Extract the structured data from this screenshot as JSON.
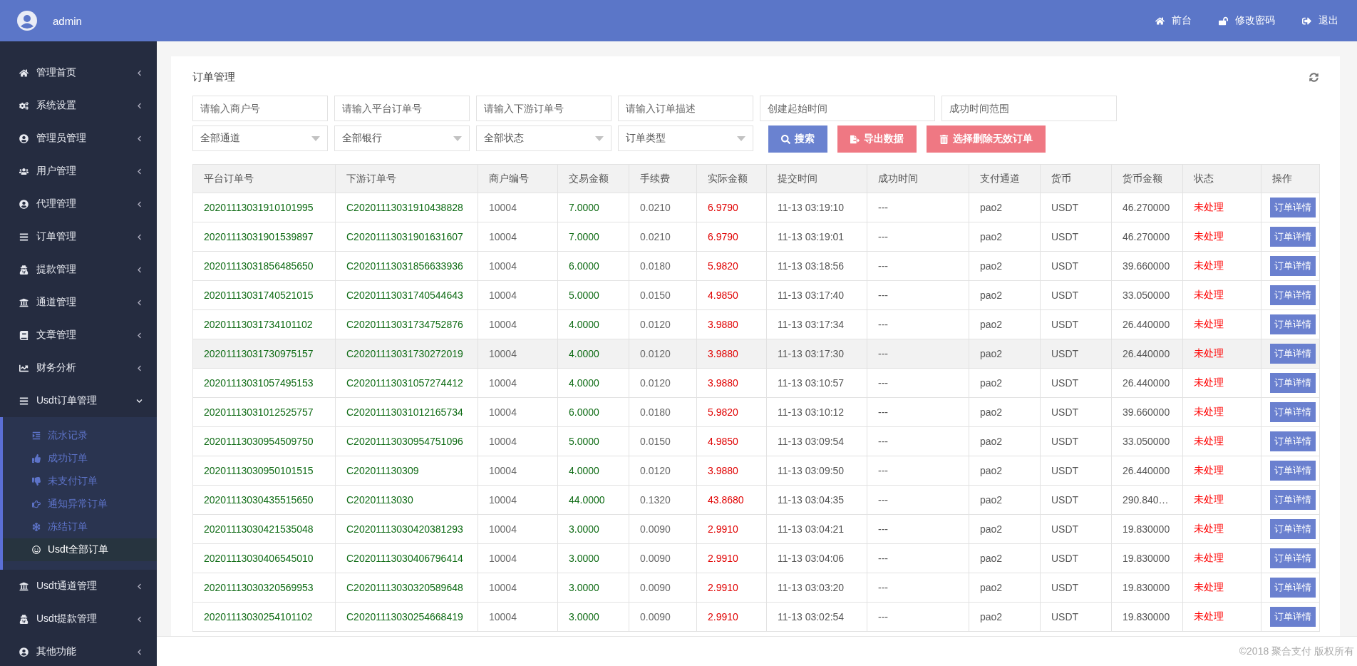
{
  "topbar": {
    "user": "admin",
    "links": [
      {
        "label": "前台"
      },
      {
        "label": "修改密码"
      },
      {
        "label": "退出"
      }
    ]
  },
  "sidebar": {
    "items": [
      {
        "label": "管理首页",
        "expanded": false
      },
      {
        "label": "系统设置",
        "expanded": false
      },
      {
        "label": "管理员管理",
        "expanded": false
      },
      {
        "label": "用户管理",
        "expanded": false
      },
      {
        "label": "代理管理",
        "expanded": false
      },
      {
        "label": "订单管理",
        "expanded": false
      },
      {
        "label": "提款管理",
        "expanded": false
      },
      {
        "label": "通道管理",
        "expanded": false
      },
      {
        "label": "文章管理",
        "expanded": false
      },
      {
        "label": "财务分析",
        "expanded": false
      },
      {
        "label": "Usdt订单管理",
        "expanded": true,
        "children": [
          {
            "label": "流水记录",
            "selected": false
          },
          {
            "label": "成功订单",
            "selected": false
          },
          {
            "label": "未支付订单",
            "selected": false
          },
          {
            "label": "通知异常订单",
            "selected": false
          },
          {
            "label": "冻结订单",
            "selected": false
          },
          {
            "label": "Usdt全部订单",
            "selected": true
          }
        ]
      },
      {
        "label": "Usdt通道管理",
        "expanded": false
      },
      {
        "label": "Usdt提款管理",
        "expanded": false
      },
      {
        "label": "其他功能",
        "expanded": false
      }
    ]
  },
  "panel": {
    "title": "订单管理",
    "filters": {
      "inputs": [
        {
          "placeholder": "请输入商户号",
          "kind": "narrow"
        },
        {
          "placeholder": "请输入平台订单号",
          "kind": "narrow"
        },
        {
          "placeholder": "请输入下游订单号",
          "kind": "narrow"
        },
        {
          "placeholder": "请输入订单描述",
          "kind": "narrow"
        },
        {
          "placeholder": "创建起始时间",
          "kind": "wide"
        },
        {
          "placeholder": "成功时间范围",
          "kind": "wide"
        }
      ],
      "selects": [
        {
          "value": "全部通道"
        },
        {
          "value": "全部银行"
        },
        {
          "value": "全部状态"
        },
        {
          "value": "订单类型"
        }
      ],
      "buttons": [
        {
          "label": "搜索",
          "kind": "primary"
        },
        {
          "label": "导出数据",
          "kind": "danger"
        },
        {
          "label": "选择删除无效订单",
          "kind": "danger"
        }
      ]
    },
    "table": {
      "columns": [
        "平台订单号",
        "下游订单号",
        "商户编号",
        "交易金额",
        "手续费",
        "实际金额",
        "提交时间",
        "成功时间",
        "支付通道",
        "货币",
        "货币金额",
        "状态",
        "操作"
      ],
      "rows": [
        {
          "platform_no": "20201113031910101995",
          "downstream_no": "C20201113031910438828",
          "merchant": "10004",
          "amount": "7.0000",
          "fee": "0.0210",
          "actual": "6.9790",
          "submitted": "11-13 03:19:10",
          "succeeded": "---",
          "channel": "pao2",
          "currency": "USDT",
          "coin_amount": "46.270000",
          "status": "未处理",
          "action": "订单详情",
          "hovered": false
        },
        {
          "platform_no": "20201113031901539897",
          "downstream_no": "C20201113031901631607",
          "merchant": "10004",
          "amount": "7.0000",
          "fee": "0.0210",
          "actual": "6.9790",
          "submitted": "11-13 03:19:01",
          "succeeded": "---",
          "channel": "pao2",
          "currency": "USDT",
          "coin_amount": "46.270000",
          "status": "未处理",
          "action": "订单详情",
          "hovered": false
        },
        {
          "platform_no": "20201113031856485650",
          "downstream_no": "C20201113031856633936",
          "merchant": "10004",
          "amount": "6.0000",
          "fee": "0.0180",
          "actual": "5.9820",
          "submitted": "11-13 03:18:56",
          "succeeded": "---",
          "channel": "pao2",
          "currency": "USDT",
          "coin_amount": "39.660000",
          "status": "未处理",
          "action": "订单详情",
          "hovered": false
        },
        {
          "platform_no": "20201113031740521015",
          "downstream_no": "C20201113031740544643",
          "merchant": "10004",
          "amount": "5.0000",
          "fee": "0.0150",
          "actual": "4.9850",
          "submitted": "11-13 03:17:40",
          "succeeded": "---",
          "channel": "pao2",
          "currency": "USDT",
          "coin_amount": "33.050000",
          "status": "未处理",
          "action": "订单详情",
          "hovered": false
        },
        {
          "platform_no": "20201113031734101102",
          "downstream_no": "C20201113031734752876",
          "merchant": "10004",
          "amount": "4.0000",
          "fee": "0.0120",
          "actual": "3.9880",
          "submitted": "11-13 03:17:34",
          "succeeded": "---",
          "channel": "pao2",
          "currency": "USDT",
          "coin_amount": "26.440000",
          "status": "未处理",
          "action": "订单详情",
          "hovered": false
        },
        {
          "platform_no": "20201113031730975157",
          "downstream_no": "C20201113031730272019",
          "merchant": "10004",
          "amount": "4.0000",
          "fee": "0.0120",
          "actual": "3.9880",
          "submitted": "11-13 03:17:30",
          "succeeded": "---",
          "channel": "pao2",
          "currency": "USDT",
          "coin_amount": "26.440000",
          "status": "未处理",
          "action": "订单详情",
          "hovered": true
        },
        {
          "platform_no": "20201113031057495153",
          "downstream_no": "C20201113031057274412",
          "merchant": "10004",
          "amount": "4.0000",
          "fee": "0.0120",
          "actual": "3.9880",
          "submitted": "11-13 03:10:57",
          "succeeded": "---",
          "channel": "pao2",
          "currency": "USDT",
          "coin_amount": "26.440000",
          "status": "未处理",
          "action": "订单详情",
          "hovered": false
        },
        {
          "platform_no": "20201113031012525757",
          "downstream_no": "C20201113031012165734",
          "merchant": "10004",
          "amount": "6.0000",
          "fee": "0.0180",
          "actual": "5.9820",
          "submitted": "11-13 03:10:12",
          "succeeded": "---",
          "channel": "pao2",
          "currency": "USDT",
          "coin_amount": "39.660000",
          "status": "未处理",
          "action": "订单详情",
          "hovered": false
        },
        {
          "platform_no": "20201113030954509750",
          "downstream_no": "C20201113030954751096",
          "merchant": "10004",
          "amount": "5.0000",
          "fee": "0.0150",
          "actual": "4.9850",
          "submitted": "11-13 03:09:54",
          "succeeded": "---",
          "channel": "pao2",
          "currency": "USDT",
          "coin_amount": "33.050000",
          "status": "未处理",
          "action": "订单详情",
          "hovered": false
        },
        {
          "platform_no": "20201113030950101515",
          "downstream_no": "C202011130309",
          "merchant": "10004",
          "amount": "4.0000",
          "fee": "0.0120",
          "actual": "3.9880",
          "submitted": "11-13 03:09:50",
          "succeeded": "---",
          "channel": "pao2",
          "currency": "USDT",
          "coin_amount": "26.440000",
          "status": "未处理",
          "action": "订单详情",
          "hovered": false
        },
        {
          "platform_no": "20201113030435515650",
          "downstream_no": "C20201113030",
          "merchant": "10004",
          "amount": "44.0000",
          "fee": "0.1320",
          "actual": "43.8680",
          "submitted": "11-13 03:04:35",
          "succeeded": "---",
          "channel": "pao2",
          "currency": "USDT",
          "coin_amount": "290.840…",
          "status": "未处理",
          "action": "订单详情",
          "hovered": false
        },
        {
          "platform_no": "20201113030421535048",
          "downstream_no": "C20201113030420381293",
          "merchant": "10004",
          "amount": "3.0000",
          "fee": "0.0090",
          "actual": "2.9910",
          "submitted": "11-13 03:04:21",
          "succeeded": "---",
          "channel": "pao2",
          "currency": "USDT",
          "coin_amount": "19.830000",
          "status": "未处理",
          "action": "订单详情",
          "hovered": false
        },
        {
          "platform_no": "20201113030406545010",
          "downstream_no": "C20201113030406796414",
          "merchant": "10004",
          "amount": "3.0000",
          "fee": "0.0090",
          "actual": "2.9910",
          "submitted": "11-13 03:04:06",
          "succeeded": "---",
          "channel": "pao2",
          "currency": "USDT",
          "coin_amount": "19.830000",
          "status": "未处理",
          "action": "订单详情",
          "hovered": false
        },
        {
          "platform_no": "20201113030320569953",
          "downstream_no": "C20201113030320589648",
          "merchant": "10004",
          "amount": "3.0000",
          "fee": "0.0090",
          "actual": "2.9910",
          "submitted": "11-13 03:03:20",
          "succeeded": "---",
          "channel": "pao2",
          "currency": "USDT",
          "coin_amount": "19.830000",
          "status": "未处理",
          "action": "订单详情",
          "hovered": false
        },
        {
          "platform_no": "20201113030254101102",
          "downstream_no": "C20201113030254668419",
          "merchant": "10004",
          "amount": "3.0000",
          "fee": "0.0090",
          "actual": "2.9910",
          "submitted": "11-13 03:02:54",
          "succeeded": "---",
          "channel": "pao2",
          "currency": "USDT",
          "coin_amount": "19.830000",
          "status": "未处理",
          "action": "订单详情",
          "hovered": false
        }
      ]
    }
  },
  "footer": {
    "copyright": "©2018 聚合支付 版权所有"
  }
}
